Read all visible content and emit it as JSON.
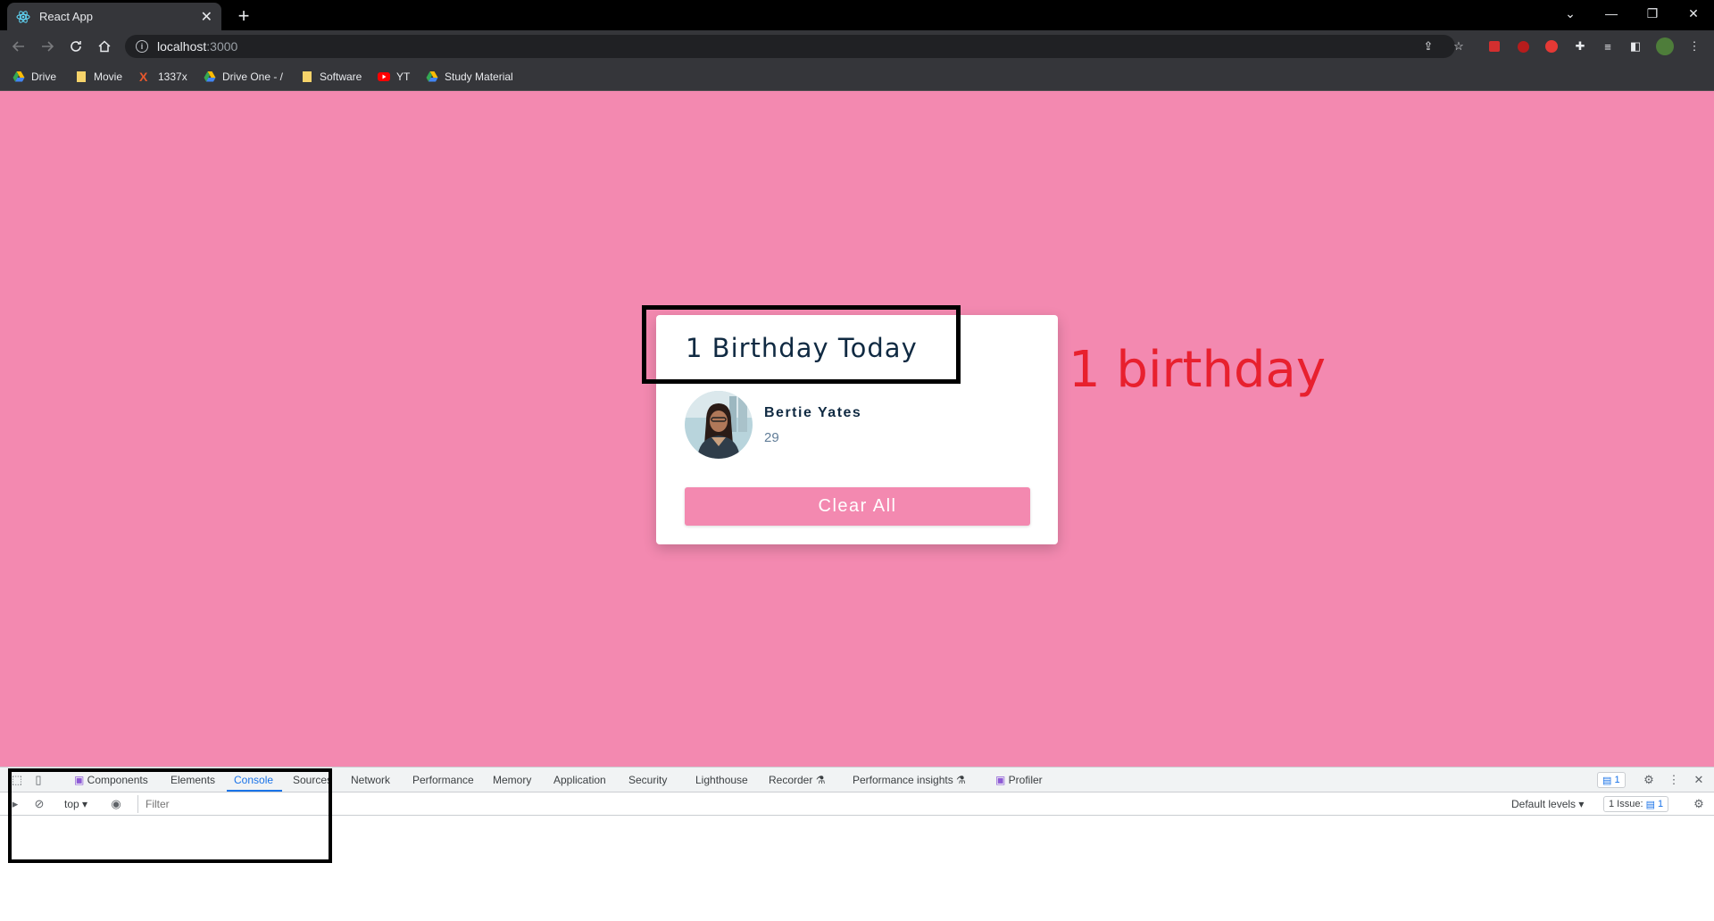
{
  "browser": {
    "tab_title": "React App",
    "url_host": "localhost",
    "url_port": ":3000",
    "bookmarks": [
      {
        "label": "Drive",
        "icon": "google-drive-icon"
      },
      {
        "label": "Movie",
        "icon": "folder-icon"
      },
      {
        "label": "1337x",
        "icon": "x-icon"
      },
      {
        "label": "Drive One - /",
        "icon": "google-drive-icon"
      },
      {
        "label": "Software",
        "icon": "folder-icon"
      },
      {
        "label": "YT",
        "icon": "youtube-icon"
      },
      {
        "label": "Study Material",
        "icon": "google-drive-icon"
      }
    ]
  },
  "page": {
    "heading": "1 Birthday Today",
    "person": {
      "name": "Bertie Yates",
      "age": "29"
    },
    "clear_button": "Clear All",
    "annotation": "1 birthday"
  },
  "devtools": {
    "tabs": [
      "Components",
      "Elements",
      "Console",
      "Sources",
      "Network",
      "Performance",
      "Memory",
      "Application",
      "Security",
      "Lighthouse",
      "Recorder",
      "Performance insights",
      "Profiler"
    ],
    "active_tab": "Console",
    "messages_badge": "1",
    "context": "top",
    "filter_placeholder": "Filter",
    "levels": "Default levels",
    "issues_label": "1 Issue:",
    "issues_count": "1"
  },
  "colors": {
    "page_bg": "#f389b0",
    "title_text": "#102a42",
    "annotation": "#e8202e",
    "devtools_accent": "#1a73e8"
  }
}
